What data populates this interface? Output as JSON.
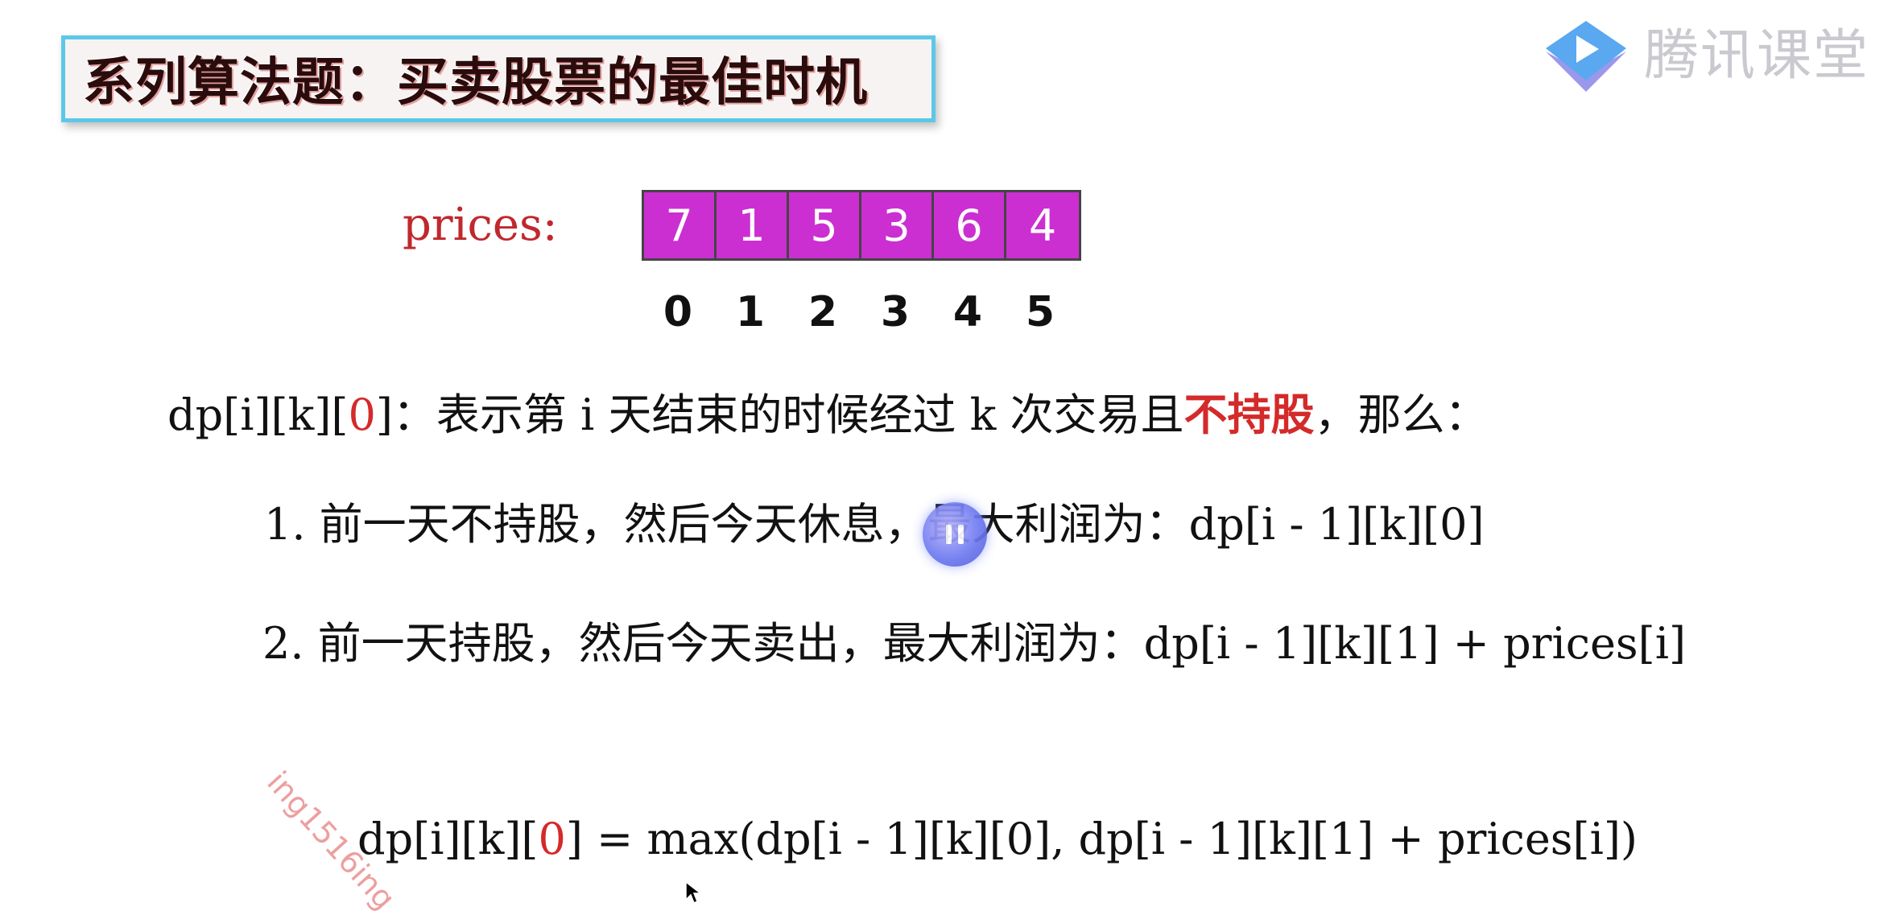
{
  "title": "系列算法题：买卖股票的最佳时机",
  "logo": {
    "icon": "play-triangle-logo-icon",
    "text": "腾讯课堂",
    "colors": {
      "primary": "#5aa8f0",
      "secondary": "#8a86e8"
    }
  },
  "prices": {
    "label": "prices:",
    "values": [
      "7",
      "1",
      "5",
      "3",
      "6",
      "4"
    ],
    "indices": [
      "0",
      "1",
      "2",
      "3",
      "4",
      "5"
    ],
    "cell_color": "#cb2fd1"
  },
  "definition": {
    "prefix": "dp[i][k][",
    "state": "0",
    "middle": "]：表示第 i 天结束的时候经过 k 次交易且",
    "emphasis": "不持股",
    "suffix": "，那么："
  },
  "case1": {
    "text": "1. 前一天不持股，然后今天休息，最大利润为：dp[i - 1][k][0]"
  },
  "case2": {
    "text": "2. 前一天持股，然后今天卖出，最大利润为：dp[i - 1][k][1] + prices[i]"
  },
  "formula": {
    "prefix": "dp[i][k][",
    "state": "0",
    "suffix": "] = max(dp[i - 1][k][0], dp[i - 1][k][1] + prices[i])"
  },
  "watermark": "ing1516ing",
  "player": {
    "pause_icon": "pause-icon"
  },
  "accent_colors": {
    "red": "#d42a2a",
    "title_border": "#5cc8e8"
  }
}
